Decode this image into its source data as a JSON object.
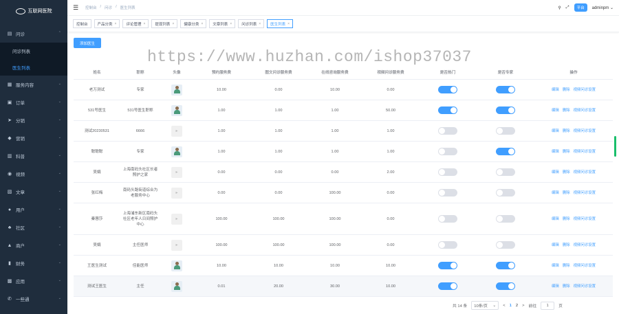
{
  "logo": {
    "text": "互联网医院"
  },
  "sidebar": {
    "items": [
      {
        "label": "问诊",
        "icon": "briefcase-icon",
        "glyph": "▤",
        "expanded": true,
        "children": [
          {
            "label": "问诊列表"
          },
          {
            "label": "医生列表"
          }
        ]
      },
      {
        "label": "服务内容",
        "icon": "grid-icon",
        "glyph": "▦"
      },
      {
        "label": "订单",
        "icon": "order-icon",
        "glyph": "▣"
      },
      {
        "label": "分销",
        "icon": "send-icon",
        "glyph": "➤"
      },
      {
        "label": "营销",
        "icon": "bag-icon",
        "glyph": "◆"
      },
      {
        "label": "科普",
        "icon": "book-icon",
        "glyph": "▥"
      },
      {
        "label": "视频",
        "icon": "camera-icon",
        "glyph": "◉"
      },
      {
        "label": "文章",
        "icon": "document-icon",
        "glyph": "▧"
      },
      {
        "label": "用户",
        "icon": "user-icon",
        "glyph": "●"
      },
      {
        "label": "社区",
        "icon": "community-icon",
        "glyph": "♣"
      },
      {
        "label": "商户",
        "icon": "shop-icon",
        "glyph": "▲"
      },
      {
        "label": "财务",
        "icon": "chart-icon",
        "glyph": "▮"
      },
      {
        "label": "应用",
        "icon": "apps-icon",
        "glyph": "▩"
      },
      {
        "label": "一些通",
        "icon": "phone-icon",
        "glyph": "✆"
      }
    ]
  },
  "navbar": {
    "breadcrumb": [
      "控制台",
      "/",
      "问诊",
      "/",
      "医生列表"
    ],
    "platform": "平台",
    "user": "adminpm"
  },
  "tags": [
    {
      "label": "控制台",
      "closable": false
    },
    {
      "label": "产品分类",
      "closable": true
    },
    {
      "label": "评论管理",
      "closable": true
    },
    {
      "label": "提现列表",
      "closable": true
    },
    {
      "label": "健康分类",
      "closable": true
    },
    {
      "label": "文章列表",
      "closable": true
    },
    {
      "label": "问诊列表",
      "closable": true
    },
    {
      "label": "医生列表",
      "closable": true,
      "active": true
    }
  ],
  "add_button": "添加医生",
  "watermark": "https://www.huzhan.com/ishop37037",
  "table": {
    "headers": [
      "姓名",
      "职称",
      "头像",
      "预约服务费",
      "图文问诊服务费",
      "在线咨询服务费",
      "视频问诊服务费",
      "是否热门",
      "是否专家",
      "操作"
    ],
    "ops": [
      "编辑",
      "删除",
      "视频问诊设置"
    ],
    "rows": [
      {
        "name": "老万测试",
        "title": "专家",
        "avatar": "image",
        "f1": "10.00",
        "f2": "0.00",
        "f3": "10.00",
        "f4": "0.00",
        "hot": true,
        "expert": true
      },
      {
        "name": "531号医生",
        "title": "531号医生职称",
        "avatar": "image",
        "f1": "1.00",
        "f2": "1.00",
        "f3": "1.00",
        "f4": "50.00",
        "hot": true,
        "expert": true
      },
      {
        "name": "测试20230531",
        "title": "6666",
        "avatar": "empty",
        "f1": "1.00",
        "f2": "1.00",
        "f3": "1.00",
        "f4": "1.00",
        "hot": false,
        "expert": false
      },
      {
        "name": "聪聪聪",
        "title": "专家",
        "avatar": "image",
        "f1": "1.00",
        "f2": "1.00",
        "f3": "1.00",
        "f4": "1.00",
        "hot": false,
        "expert": true
      },
      {
        "name": "吴娟",
        "title": "上海南码头社区长者照护之家",
        "avatar": "empty",
        "f1": "0.00",
        "f2": "0.00",
        "f3": "0.00",
        "f4": "2.00",
        "hot": false,
        "expert": false
      },
      {
        "name": "张红梅",
        "title": "南码头路街道综合为老服务中心",
        "avatar": "empty",
        "f1": "0.00",
        "f2": "0.00",
        "f3": "100.00",
        "f4": "0.00",
        "hot": false,
        "expert": false
      },
      {
        "name": "秦蓉莎",
        "title": "上海浦东新区南码头社区老年人日间照护中心",
        "avatar": "empty",
        "f1": "100.00",
        "f2": "100.00",
        "f3": "100.00",
        "f4": "0.00",
        "hot": false,
        "expert": false
      },
      {
        "name": "吴娟",
        "title": "主任医师",
        "avatar": "empty",
        "f1": "100.00",
        "f2": "100.00",
        "f3": "100.00",
        "f4": "0.00",
        "hot": false,
        "expert": false
      },
      {
        "name": "王医生测试",
        "title": "佳能医师",
        "avatar": "image",
        "f1": "10.00",
        "f2": "10.00",
        "f3": "10.00",
        "f4": "10.00",
        "hot": true,
        "expert": true
      },
      {
        "name": "测试王医生",
        "title": "主任",
        "avatar": "image",
        "f1": "0.01",
        "f2": "20.00",
        "f3": "30.00",
        "f4": "10.00",
        "hot": true,
        "expert": true
      }
    ]
  },
  "pagination": {
    "total": "共 14 条",
    "page_size": "10条/页",
    "prev": "<",
    "pages": [
      "1",
      "2"
    ],
    "current_page": "1",
    "next": ">",
    "goto_label": "前往",
    "goto_value": "1",
    "goto_suffix": "页"
  }
}
